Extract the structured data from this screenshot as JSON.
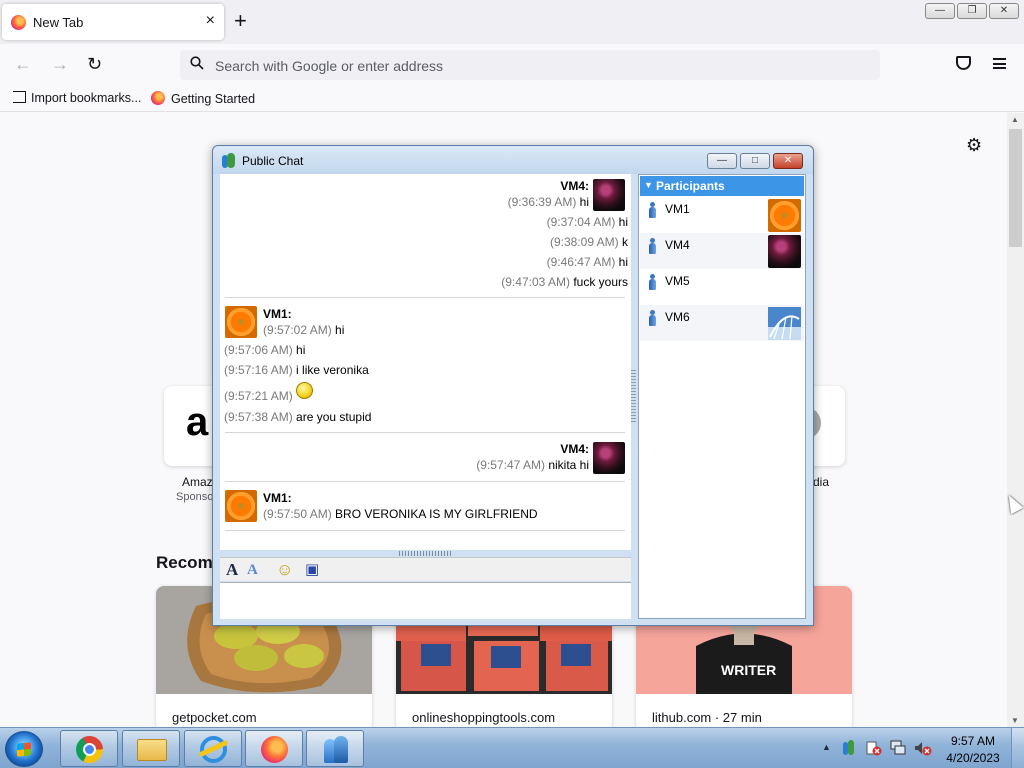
{
  "browser": {
    "tab_title": "New Tab",
    "tab_close_glyph": "×",
    "new_tab_glyph": "+",
    "window_min_glyph": "—",
    "window_restore_glyph": "❐",
    "window_close_glyph": "✕",
    "back_glyph": "←",
    "forward_glyph": "→",
    "reload_glyph": "↻",
    "url_placeholder": "Search with Google or enter address",
    "bookmarks": [
      {
        "label": "Import bookmarks...",
        "icon": "import-icon"
      },
      {
        "label": "Getting Started",
        "icon": "firefox-icon"
      }
    ]
  },
  "newtab": {
    "settings_glyph": "⚙",
    "shortcuts": [
      {
        "label": "Amaz",
        "sub": "Sponso",
        "icon": "amazon-icon"
      },
      {
        "label": "dia",
        "sub": "",
        "icon": "wikipedia-icon"
      }
    ],
    "recommended_title": "Recomm",
    "cards": [
      {
        "source": "getpocket.com",
        "image": "pickles-on-bread-image"
      },
      {
        "source": "onlineshoppingtools.com",
        "image": "ground-meat-packages-image"
      },
      {
        "source": "lithub.com · 27 min",
        "image": "writer-shirt-image",
        "image_text": "WRITER"
      }
    ]
  },
  "chat": {
    "title": "Public Chat",
    "min_glyph": "—",
    "max_glyph": "□",
    "close_glyph": "✕",
    "blocks": [
      {
        "sender": "VM4:",
        "align": "right",
        "avatar": "ball",
        "lines": [
          {
            "time": "(9:36:39 AM)",
            "text": "hi"
          },
          {
            "time": "(9:37:04 AM)",
            "text": "hi"
          },
          {
            "time": "(9:38:09 AM)",
            "text": "k"
          },
          {
            "time": "(9:46:47 AM)",
            "text": "hi"
          },
          {
            "time": "(9:47:03 AM)",
            "text": "fuck yours"
          }
        ]
      },
      {
        "sender": "VM1:",
        "align": "left",
        "avatar": "flower",
        "lines": [
          {
            "time": "(9:57:02 AM)",
            "text": "hi"
          },
          {
            "time": "(9:57:06 AM)",
            "text": "hi"
          },
          {
            "time": "(9:57:16 AM)",
            "text": "i like veronika"
          },
          {
            "time": "(9:57:21 AM)",
            "text": "",
            "emoticon": "smiley-icon"
          },
          {
            "time": "(9:57:38 AM)",
            "text": "are you stupid"
          }
        ]
      },
      {
        "sender": "VM4:",
        "align": "right",
        "avatar": "ball",
        "lines": [
          {
            "time": "(9:57:47 AM)",
            "text": "nikita hi"
          }
        ]
      },
      {
        "sender": "VM1:",
        "align": "left",
        "avatar": "flower",
        "lines": [
          {
            "time": "(9:57:50 AM)",
            "text": "BRO VERONIKA IS MY GIRLFRIEND"
          }
        ]
      }
    ],
    "toolbar": [
      {
        "name": "font-icon",
        "glyph": "A"
      },
      {
        "name": "font-color-icon",
        "glyph": "A"
      },
      {
        "name": "emoticon-icon",
        "glyph": "☺"
      },
      {
        "name": "save-icon",
        "glyph": "▣"
      }
    ],
    "participants_header": "Participants",
    "participants": [
      {
        "name": "VM1",
        "avatar": "flower"
      },
      {
        "name": "VM4",
        "avatar": "ball"
      },
      {
        "name": "VM5",
        "avatar": ""
      },
      {
        "name": "VM6",
        "avatar": "sky"
      }
    ]
  },
  "taskbar": {
    "apps": [
      "chrome-icon",
      "file-explorer-icon",
      "internet-explorer-icon",
      "firefox-icon",
      "public-chat-icon"
    ],
    "tray_expand_glyph": "▲",
    "time": "9:57 AM",
    "date": "4/20/2023"
  },
  "colors": {
    "participants_header": "#3d95e8",
    "chat_frame": "#cfe0f2",
    "taskbar": "#8fb2d8"
  }
}
